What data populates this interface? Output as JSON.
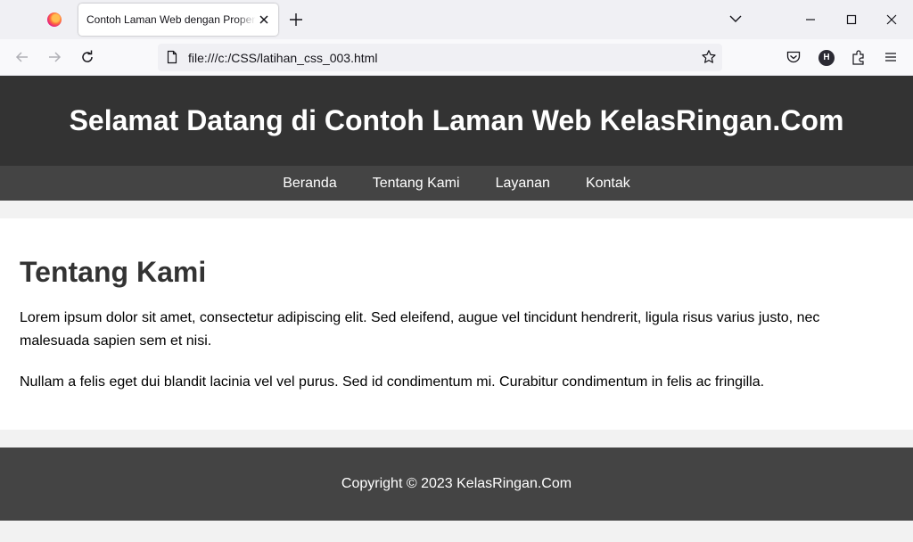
{
  "browser": {
    "tab_title": "Contoh Laman Web dengan Properti CSS",
    "url": "file:///c:/CSS/latihan_css_003.html",
    "extension_badge": "H"
  },
  "page": {
    "header_title": "Selamat Datang di Contoh Laman Web KelasRingan.Com",
    "nav": [
      "Beranda",
      "Tentang Kami",
      "Layanan",
      "Kontak"
    ],
    "section_heading": "Tentang Kami",
    "paragraphs": [
      "Lorem ipsum dolor sit amet, consectetur adipiscing elit. Sed eleifend, augue vel tincidunt hendrerit, ligula risus varius justo, nec malesuada sapien sem et nisi.",
      "Nullam a felis eget dui blandit lacinia vel vel purus. Sed id condimentum mi. Curabitur condimentum in felis ac fringilla."
    ],
    "footer": "Copyright © 2023 KelasRingan.Com"
  },
  "colors": {
    "header_bg": "#333333",
    "nav_bg": "#444444",
    "footer_bg": "#444444",
    "content_bg": "#ffffff",
    "page_bg": "#f2f2f2"
  },
  "icons": [
    "firefox-logo-icon",
    "close-icon",
    "plus-icon",
    "chevron-down-icon",
    "minimize-icon",
    "maximize-icon",
    "back-icon",
    "forward-icon",
    "reload-icon",
    "page-icon",
    "star-icon",
    "pocket-icon",
    "extensions-icon",
    "menu-icon"
  ]
}
